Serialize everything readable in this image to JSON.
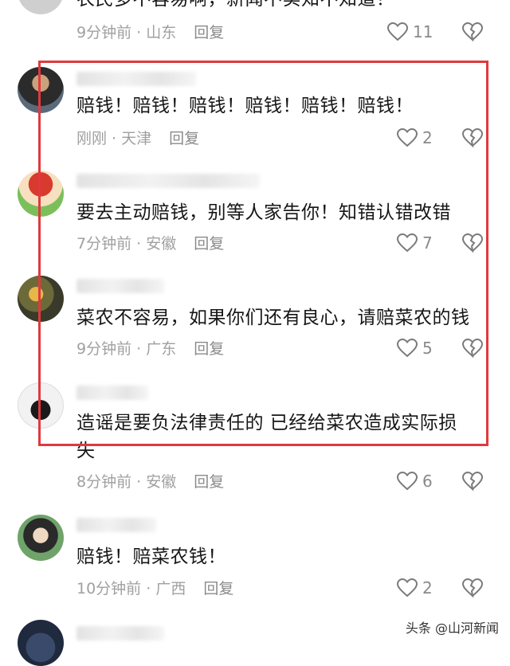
{
  "comments": [
    {
      "text": "农民多不容易啊，新闻不实知不知道？",
      "time": "9分钟前",
      "location": "山东",
      "reply": "回复",
      "likes": "11"
    },
    {
      "text": "赔钱！赔钱！赔钱！赔钱！赔钱！赔钱！",
      "time": "刚刚",
      "location": "天津",
      "reply": "回复",
      "likes": "2"
    },
    {
      "text": "要去主动赔钱，别等人家告你！知错认错改错",
      "time": "7分钟前",
      "location": "安徽",
      "reply": "回复",
      "likes": "7"
    },
    {
      "text": "菜农不容易，如果你们还有良心，请赔菜农的钱",
      "time": "9分钟前",
      "location": "广东",
      "reply": "回复",
      "likes": "5"
    },
    {
      "text": "造谣是要负法律责任的 已经给菜农造成实际损失",
      "time": "8分钟前",
      "location": "安徽",
      "reply": "回复",
      "likes": "6"
    },
    {
      "text": "赔钱！赔菜农钱！",
      "time": "10分钟前",
      "location": "广西",
      "reply": "回复",
      "likes": "2"
    }
  ],
  "separator": " · ",
  "watermark": "头条 @山河新闻",
  "icons": {
    "like": "heart-outline-icon",
    "dislike": "broken-heart-icon"
  },
  "colors": {
    "highlight": "#e0393e",
    "meta": "#a0a0a0"
  }
}
